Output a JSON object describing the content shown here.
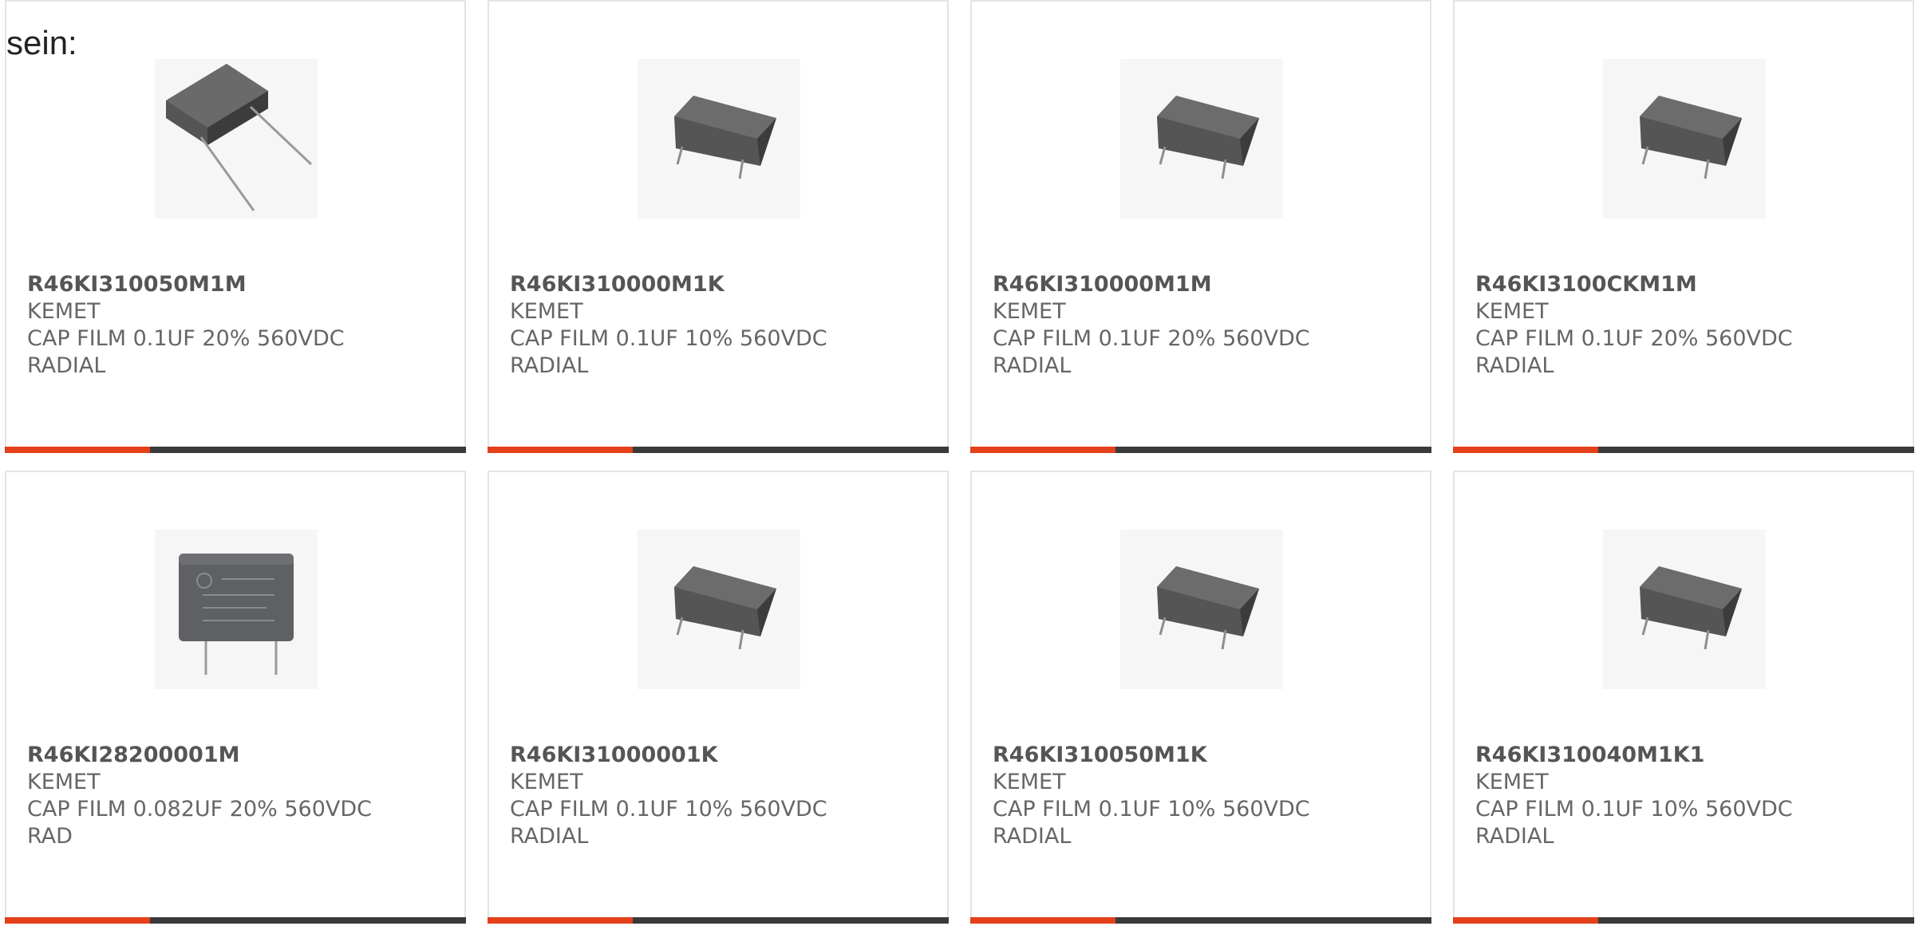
{
  "intro_text": "sein:",
  "colors": {
    "accent": "#e4401a",
    "bar_dark": "#3a3a3a",
    "border": "#e4e4e4",
    "text": "#666666"
  },
  "products": [
    {
      "part": "R46KI310050M1M",
      "maker": "KEMET",
      "desc1": "CAP FILM 0.1UF 20% 560VDC",
      "desc2": "RADIAL",
      "image": "capacitor-long-leads-icon"
    },
    {
      "part": "R46KI310000M1K",
      "maker": "KEMET",
      "desc1": "CAP FILM 0.1UF 10% 560VDC",
      "desc2": "RADIAL",
      "image": "capacitor-short-leads-icon"
    },
    {
      "part": "R46KI310000M1M",
      "maker": "KEMET",
      "desc1": "CAP FILM 0.1UF 20% 560VDC",
      "desc2": "RADIAL",
      "image": "capacitor-short-leads-icon"
    },
    {
      "part": "R46KI3100CKM1M",
      "maker": "KEMET",
      "desc1": "CAP FILM 0.1UF 20% 560VDC",
      "desc2": "RADIAL",
      "image": "capacitor-short-leads-icon"
    },
    {
      "part": "R46KI28200001M",
      "maker": "KEMET",
      "desc1": "CAP FILM 0.082UF 20% 560VDC",
      "desc2": "RAD",
      "image": "capacitor-front-icon"
    },
    {
      "part": "R46KI31000001K",
      "maker": "KEMET",
      "desc1": "CAP FILM 0.1UF 10% 560VDC",
      "desc2": "RADIAL",
      "image": "capacitor-short-leads-icon"
    },
    {
      "part": "R46KI310050M1K",
      "maker": "KEMET",
      "desc1": "CAP FILM 0.1UF 10% 560VDC",
      "desc2": "RADIAL",
      "image": "capacitor-short-leads-icon"
    },
    {
      "part": "R46KI310040M1K1",
      "maker": "KEMET",
      "desc1": "CAP FILM 0.1UF 10% 560VDC",
      "desc2": "RADIAL",
      "image": "capacitor-short-leads-icon"
    }
  ]
}
